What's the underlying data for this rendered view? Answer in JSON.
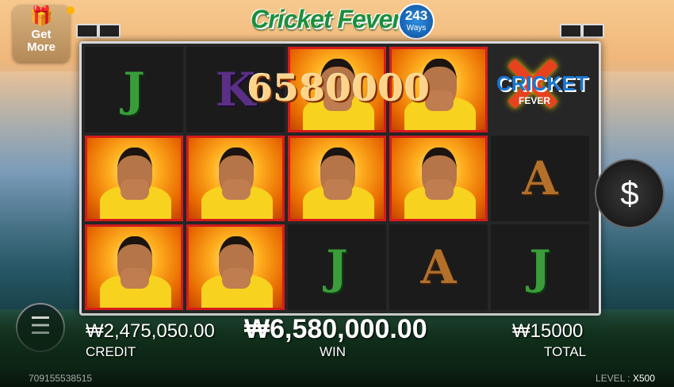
{
  "header": {
    "get_more_label_1": "Get",
    "get_more_label_2": "More",
    "logo_title": "Cricket Fever",
    "logo_ways_number": "243",
    "logo_ways_label": "Ways"
  },
  "wild": {
    "label_line1": "CRICKET",
    "label_line2": "FEVER"
  },
  "reels": {
    "win_amount_overlay": "6580000",
    "symbols": [
      [
        "J",
        "cricketer",
        "cricketer"
      ],
      [
        "K",
        "cricketer",
        "cricketer"
      ],
      [
        "cricketer",
        "cricketer",
        "J"
      ],
      [
        "cricketer",
        "cricketer",
        "A"
      ],
      [
        "wild",
        "A",
        "J"
      ]
    ]
  },
  "hud": {
    "credit_value": "₩2,475,050.00",
    "credit_label": "CREDIT",
    "win_value": "₩6,580,000.00",
    "win_label": "WIN",
    "total_value": "₩15000",
    "total_label": "TOTAL",
    "spin_icon": "$"
  },
  "footer": {
    "session_id": "709155538515",
    "level_label": "LEVEL :",
    "level_value": "X500"
  },
  "colors": {
    "highlight": "#d61b1b",
    "accent_gold": "#ffd38a"
  }
}
